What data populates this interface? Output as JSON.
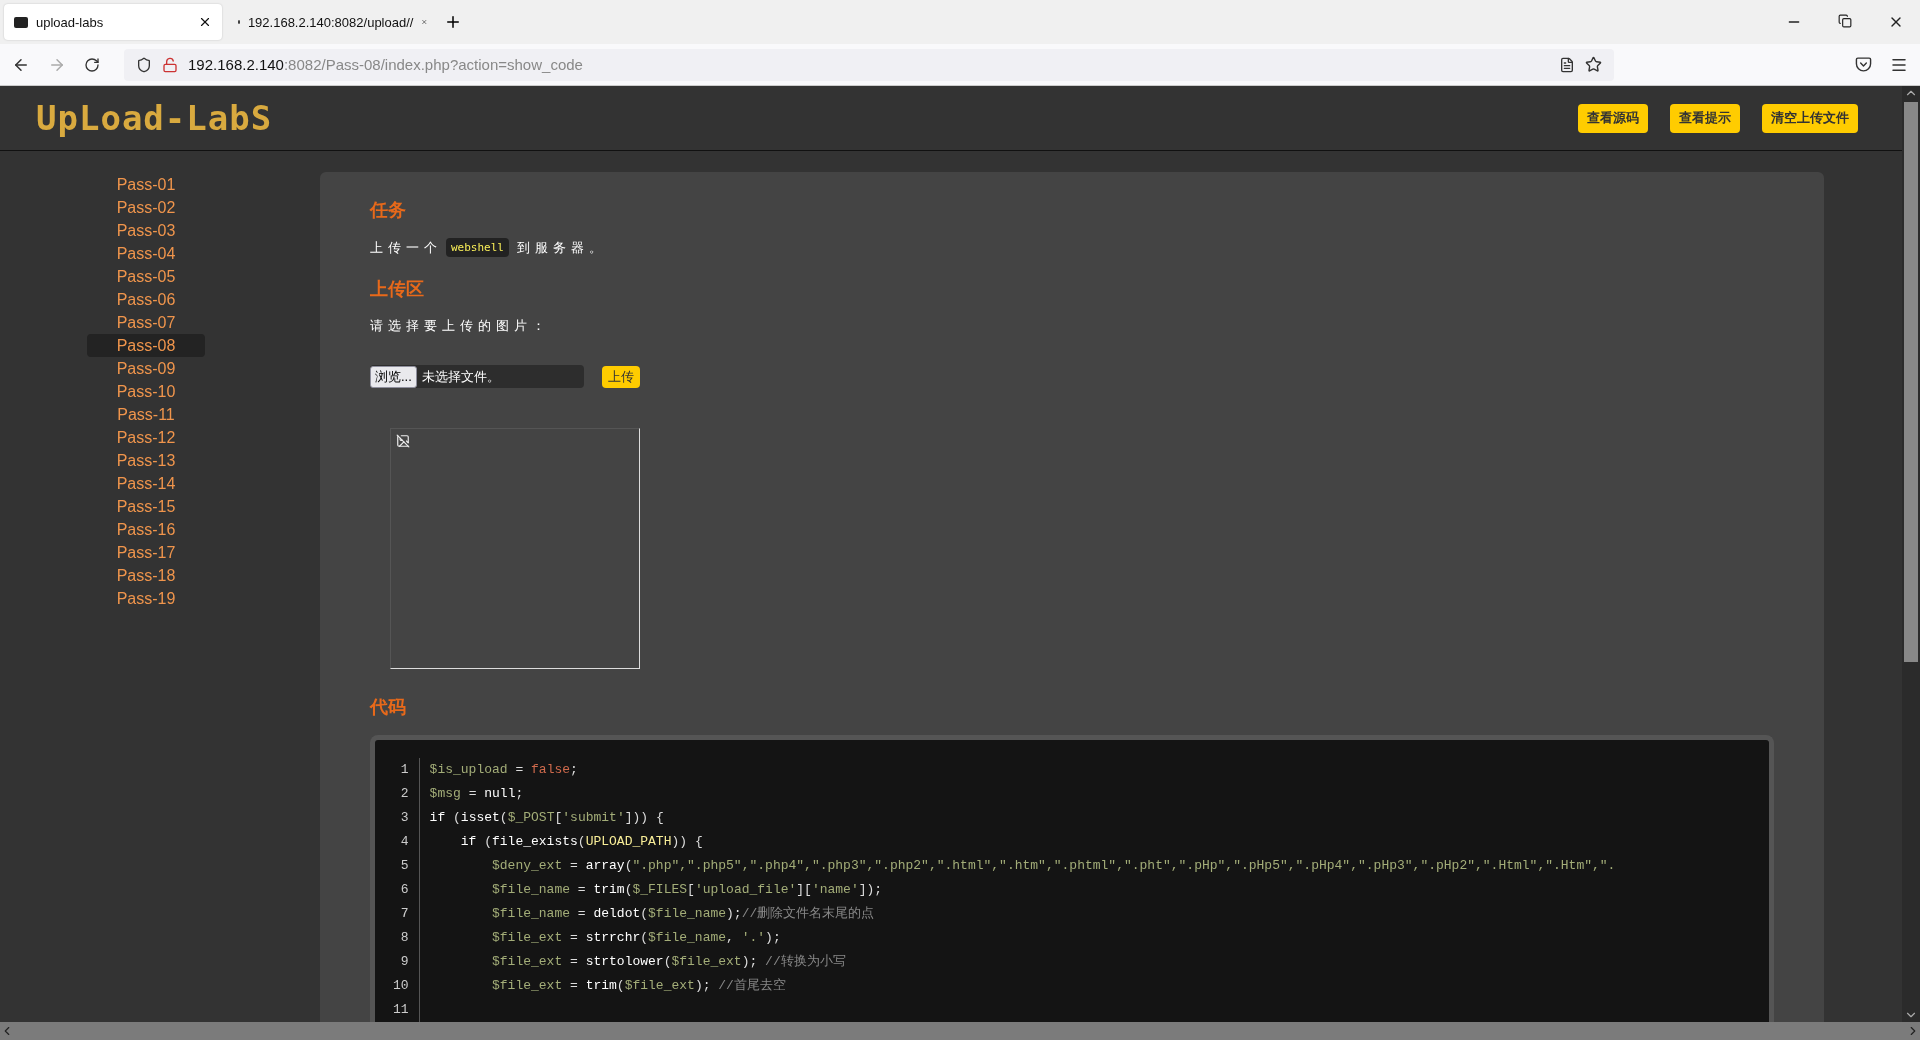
{
  "browser": {
    "tabs": [
      {
        "title": "upload-labs",
        "selected": true
      },
      {
        "title": "192.168.2.140:8082/upload//",
        "selected": false
      }
    ],
    "url_host": "192.168.2.140",
    "url_rest": ":8082/Pass-08/index.php?action=show_code"
  },
  "header": {
    "logo": "UpLoad-LabS",
    "buttons": [
      "查看源码",
      "查看提示",
      "清空上传文件"
    ]
  },
  "sidebar": {
    "items": [
      {
        "label": "Pass-01",
        "selected": false
      },
      {
        "label": "Pass-02",
        "selected": false
      },
      {
        "label": "Pass-03",
        "selected": false
      },
      {
        "label": "Pass-04",
        "selected": false
      },
      {
        "label": "Pass-05",
        "selected": false
      },
      {
        "label": "Pass-06",
        "selected": false
      },
      {
        "label": "Pass-07",
        "selected": false
      },
      {
        "label": "Pass-08",
        "selected": true
      },
      {
        "label": "Pass-09",
        "selected": false
      },
      {
        "label": "Pass-10",
        "selected": false
      },
      {
        "label": "Pass-11",
        "selected": false
      },
      {
        "label": "Pass-12",
        "selected": false
      },
      {
        "label": "Pass-13",
        "selected": false
      },
      {
        "label": "Pass-14",
        "selected": false
      },
      {
        "label": "Pass-15",
        "selected": false
      },
      {
        "label": "Pass-16",
        "selected": false
      },
      {
        "label": "Pass-17",
        "selected": false
      },
      {
        "label": "Pass-18",
        "selected": false
      },
      {
        "label": "Pass-19",
        "selected": false
      }
    ]
  },
  "task": {
    "heading": "任务",
    "text_before": "上传一个",
    "code": "webshell",
    "text_after": "到服务器。"
  },
  "upload": {
    "heading": "上传区",
    "prompt": "请选择要上传的图片：",
    "browse_button": "浏览...",
    "file_status": "未选择文件。",
    "submit_button": "上传"
  },
  "code": {
    "heading": "代码",
    "lines": [
      {
        "number": "1",
        "tokens": [
          {
            "kind": "var",
            "text": "$is_upload"
          },
          {
            "kind": "plain",
            "text": " = "
          },
          {
            "kind": "bool",
            "text": "false"
          },
          {
            "kind": "plain",
            "text": ";"
          }
        ]
      },
      {
        "number": "2",
        "tokens": [
          {
            "kind": "var",
            "text": "$msg"
          },
          {
            "kind": "plain",
            "text": " = "
          },
          {
            "kind": "kw",
            "text": "null"
          },
          {
            "kind": "plain",
            "text": ";"
          }
        ]
      },
      {
        "number": "3",
        "tokens": [
          {
            "kind": "kw",
            "text": "if"
          },
          {
            "kind": "plain",
            "text": " ("
          },
          {
            "kind": "kw",
            "text": "isset"
          },
          {
            "kind": "plain",
            "text": "("
          },
          {
            "kind": "var",
            "text": "$_POST"
          },
          {
            "kind": "plain",
            "text": "["
          },
          {
            "kind": "str",
            "text": "'submit'"
          },
          {
            "kind": "plain",
            "text": "])) {"
          }
        ],
        "children": [
          {
            "number": "4",
            "tokens": [
              {
                "kind": "kw",
                "text": "if"
              },
              {
                "kind": "plain",
                "text": " ("
              },
              {
                "kind": "kw",
                "text": "file_exists"
              },
              {
                "kind": "plain",
                "text": "("
              },
              {
                "kind": "const",
                "text": "UPLOAD_PATH"
              },
              {
                "kind": "plain",
                "text": ")) {"
              }
            ],
            "children": [
              {
                "number": "5",
                "tokens": [
                  {
                    "kind": "var",
                    "text": "$deny_ext"
                  },
                  {
                    "kind": "plain",
                    "text": " = "
                  },
                  {
                    "kind": "kw",
                    "text": "array"
                  },
                  {
                    "kind": "plain",
                    "text": "("
                  },
                  {
                    "kind": "str",
                    "text": "\".php\",\".php5\",\".php4\",\".php3\",\".php2\",\".html\",\".htm\",\".phtml\",\".pht\",\".pHp\",\".pHp5\",\".pHp4\",\".pHp3\",\".pHp2\",\".Html\",\".Htm\",\"."
                  }
                ]
              },
              {
                "number": "6",
                "tokens": [
                  {
                    "kind": "var",
                    "text": "$file_name"
                  },
                  {
                    "kind": "plain",
                    "text": " = "
                  },
                  {
                    "kind": "kw",
                    "text": "trim"
                  },
                  {
                    "kind": "plain",
                    "text": "("
                  },
                  {
                    "kind": "var",
                    "text": "$_FILES"
                  },
                  {
                    "kind": "plain",
                    "text": "["
                  },
                  {
                    "kind": "str",
                    "text": "'upload_file'"
                  },
                  {
                    "kind": "plain",
                    "text": "]["
                  },
                  {
                    "kind": "str",
                    "text": "'name'"
                  },
                  {
                    "kind": "plain",
                    "text": "]);"
                  }
                ]
              },
              {
                "number": "7",
                "tokens": [
                  {
                    "kind": "var",
                    "text": "$file_name"
                  },
                  {
                    "kind": "plain",
                    "text": " = "
                  },
                  {
                    "kind": "kw",
                    "text": "deldot"
                  },
                  {
                    "kind": "plain",
                    "text": "("
                  },
                  {
                    "kind": "var",
                    "text": "$file_name"
                  },
                  {
                    "kind": "plain",
                    "text": ");"
                  },
                  {
                    "kind": "comment",
                    "text": "//删除文件名末尾的点"
                  }
                ]
              },
              {
                "number": "8",
                "tokens": [
                  {
                    "kind": "var",
                    "text": "$file_ext"
                  },
                  {
                    "kind": "plain",
                    "text": " = "
                  },
                  {
                    "kind": "kw",
                    "text": "strrchr"
                  },
                  {
                    "kind": "plain",
                    "text": "("
                  },
                  {
                    "kind": "var",
                    "text": "$file_name"
                  },
                  {
                    "kind": "plain",
                    "text": ", "
                  },
                  {
                    "kind": "str",
                    "text": "'.'"
                  },
                  {
                    "kind": "plain",
                    "text": ");"
                  }
                ]
              },
              {
                "number": "9",
                "tokens": [
                  {
                    "kind": "var",
                    "text": "$file_ext"
                  },
                  {
                    "kind": "plain",
                    "text": " = "
                  },
                  {
                    "kind": "kw",
                    "text": "strtolower"
                  },
                  {
                    "kind": "plain",
                    "text": "("
                  },
                  {
                    "kind": "var",
                    "text": "$file_ext"
                  },
                  {
                    "kind": "plain",
                    "text": "); "
                  },
                  {
                    "kind": "comment",
                    "text": "//转换为小写"
                  }
                ]
              },
              {
                "number": "10",
                "tokens": [
                  {
                    "kind": "var",
                    "text": "$file_ext"
                  },
                  {
                    "kind": "plain",
                    "text": " = "
                  },
                  {
                    "kind": "kw",
                    "text": "trim"
                  },
                  {
                    "kind": "plain",
                    "text": "("
                  },
                  {
                    "kind": "var",
                    "text": "$file_ext"
                  },
                  {
                    "kind": "plain",
                    "text": "); "
                  },
                  {
                    "kind": "comment",
                    "text": "//首尾去空"
                  }
                ]
              },
              {
                "number": "11"
              }
            ]
          }
        ]
      }
    ]
  }
}
